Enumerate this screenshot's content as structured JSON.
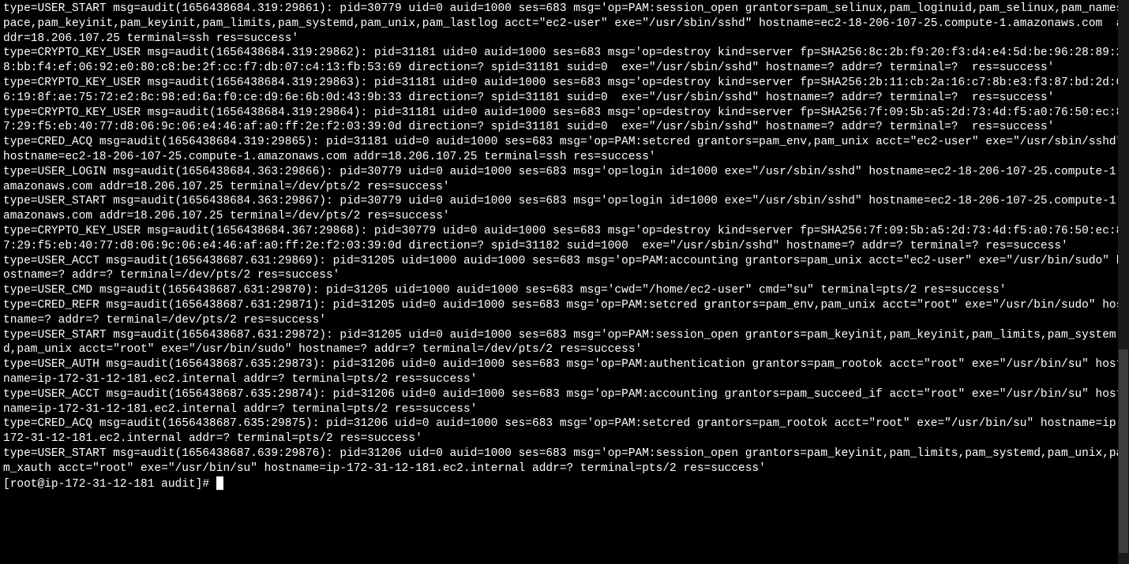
{
  "audit_lines": [
    "type=USER_START msg=audit(1656438684.319:29861): pid=30779 uid=0 auid=1000 ses=683 msg='op=PAM:session_open grantors=pam_selinux,pam_loginuid,pam_selinux,pam_namespace,pam_keyinit,pam_keyinit,pam_limits,pam_systemd,pam_unix,pam_lastlog acct=\"ec2-user\" exe=\"/usr/sbin/sshd\" hostname=ec2-18-206-107-25.compute-1.amazonaws.com  addr=18.206.107.25 terminal=ssh res=success'",
    "type=CRYPTO_KEY_USER msg=audit(1656438684.319:29862): pid=31181 uid=0 auid=1000 ses=683 msg='op=destroy kind=server fp=SHA256:8c:2b:f9:20:f3:d4:e4:5d:be:96:28:89:28:bb:f4:ef:06:92:e0:80:c8:be:2f:cc:f7:db:07:c4:13:fb:53:69 direction=? spid=31181 suid=0  exe=\"/usr/sbin/sshd\" hostname=? addr=? terminal=?  res=success'",
    "type=CRYPTO_KEY_USER msg=audit(1656438684.319:29863): pid=31181 uid=0 auid=1000 ses=683 msg='op=destroy kind=server fp=SHA256:2b:11:cb:2a:16:c7:8b:e3:f3:87:bd:2d:06:19:8f:ae:75:72:e2:8c:98:ed:6a:f0:ce:d9:6e:6b:0d:43:9b:33 direction=? spid=31181 suid=0  exe=\"/usr/sbin/sshd\" hostname=? addr=? terminal=?  res=success'",
    "type=CRYPTO_KEY_USER msg=audit(1656438684.319:29864): pid=31181 uid=0 auid=1000 ses=683 msg='op=destroy kind=server fp=SHA256:7f:09:5b:a5:2d:73:4d:f5:a0:76:50:ec:87:29:f5:eb:40:77:d8:06:9c:06:e4:46:af:a0:ff:2e:f2:03:39:0d direction=? spid=31181 suid=0  exe=\"/usr/sbin/sshd\" hostname=? addr=? terminal=?  res=success'",
    "type=CRED_ACQ msg=audit(1656438684.319:29865): pid=31181 uid=0 auid=1000 ses=683 msg='op=PAM:setcred grantors=pam_env,pam_unix acct=\"ec2-user\" exe=\"/usr/sbin/sshd\" hostname=ec2-18-206-107-25.compute-1.amazonaws.com addr=18.206.107.25 terminal=ssh res=success'",
    "type=USER_LOGIN msg=audit(1656438684.363:29866): pid=30779 uid=0 auid=1000 ses=683 msg='op=login id=1000 exe=\"/usr/sbin/sshd\" hostname=ec2-18-206-107-25.compute-1.amazonaws.com addr=18.206.107.25 terminal=/dev/pts/2 res=success'",
    "type=USER_START msg=audit(1656438684.363:29867): pid=30779 uid=0 auid=1000 ses=683 msg='op=login id=1000 exe=\"/usr/sbin/sshd\" hostname=ec2-18-206-107-25.compute-1.amazonaws.com addr=18.206.107.25 terminal=/dev/pts/2 res=success'",
    "type=CRYPTO_KEY_USER msg=audit(1656438684.367:29868): pid=30779 uid=0 auid=1000 ses=683 msg='op=destroy kind=server fp=SHA256:7f:09:5b:a5:2d:73:4d:f5:a0:76:50:ec:87:29:f5:eb:40:77:d8:06:9c:06:e4:46:af:a0:ff:2e:f2:03:39:0d direction=? spid=31182 suid=1000  exe=\"/usr/sbin/sshd\" hostname=? addr=? terminal=? res=success'",
    "type=USER_ACCT msg=audit(1656438687.631:29869): pid=31205 uid=1000 auid=1000 ses=683 msg='op=PAM:accounting grantors=pam_unix acct=\"ec2-user\" exe=\"/usr/bin/sudo\" hostname=? addr=? terminal=/dev/pts/2 res=success'",
    "type=USER_CMD msg=audit(1656438687.631:29870): pid=31205 uid=1000 auid=1000 ses=683 msg='cwd=\"/home/ec2-user\" cmd=\"su\" terminal=pts/2 res=success'",
    "type=CRED_REFR msg=audit(1656438687.631:29871): pid=31205 uid=0 auid=1000 ses=683 msg='op=PAM:setcred grantors=pam_env,pam_unix acct=\"root\" exe=\"/usr/bin/sudo\" hostname=? addr=? terminal=/dev/pts/2 res=success'",
    "type=USER_START msg=audit(1656438687.631:29872): pid=31205 uid=0 auid=1000 ses=683 msg='op=PAM:session_open grantors=pam_keyinit,pam_keyinit,pam_limits,pam_systemd,pam_unix acct=\"root\" exe=\"/usr/bin/sudo\" hostname=? addr=? terminal=/dev/pts/2 res=success'",
    "type=USER_AUTH msg=audit(1656438687.635:29873): pid=31206 uid=0 auid=1000 ses=683 msg='op=PAM:authentication grantors=pam_rootok acct=\"root\" exe=\"/usr/bin/su\" hostname=ip-172-31-12-181.ec2.internal addr=? terminal=pts/2 res=success'",
    "type=USER_ACCT msg=audit(1656438687.635:29874): pid=31206 uid=0 auid=1000 ses=683 msg='op=PAM:accounting grantors=pam_succeed_if acct=\"root\" exe=\"/usr/bin/su\" hostname=ip-172-31-12-181.ec2.internal addr=? terminal=pts/2 res=success'",
    "type=CRED_ACQ msg=audit(1656438687.635:29875): pid=31206 uid=0 auid=1000 ses=683 msg='op=PAM:setcred grantors=pam_rootok acct=\"root\" exe=\"/usr/bin/su\" hostname=ip-172-31-12-181.ec2.internal addr=? terminal=pts/2 res=success'",
    "type=USER_START msg=audit(1656438687.639:29876): pid=31206 uid=0 auid=1000 ses=683 msg='op=PAM:session_open grantors=pam_keyinit,pam_limits,pam_systemd,pam_unix,pam_xauth acct=\"root\" exe=\"/usr/bin/su\" hostname=ip-172-31-12-181.ec2.internal addr=? terminal=pts/2 res=success'"
  ],
  "prompt": "[root@ip-172-31-12-181 audit]# ",
  "scrollbar": {
    "thumb_top_pct": 62,
    "thumb_height_pct": 36
  }
}
